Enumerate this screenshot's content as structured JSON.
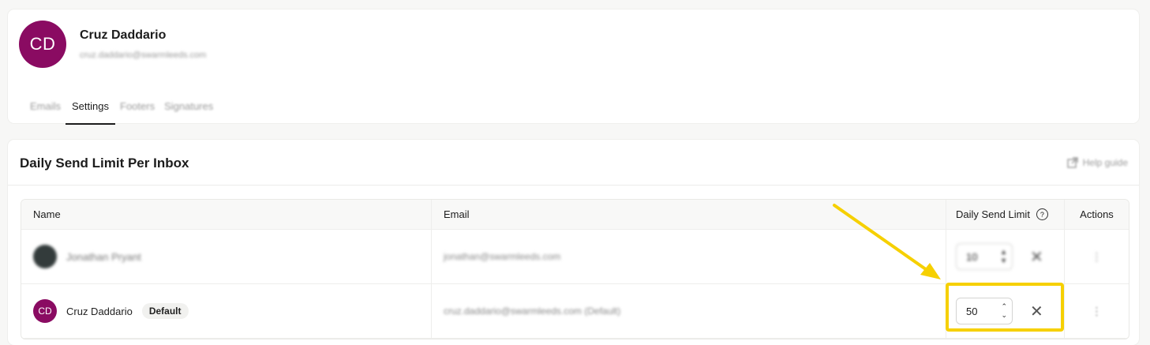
{
  "profile": {
    "initials": "CD",
    "name": "Cruz Daddario",
    "email": "cruz.daddario@swarmleeds.com",
    "avatar_color": "#8a0b62"
  },
  "tabs": [
    {
      "label": "Emails",
      "active": false
    },
    {
      "label": "Settings",
      "active": true
    },
    {
      "label": "Footers",
      "active": false
    },
    {
      "label": "Signatures",
      "active": false
    }
  ],
  "section": {
    "title": "Daily Send Limit Per Inbox",
    "help_label": "Help guide"
  },
  "table": {
    "headers": {
      "name": "Name",
      "email": "Email",
      "limit": "Daily Send Limit",
      "actions": "Actions"
    },
    "rows": [
      {
        "initials": "",
        "name": "Jonathan Pryant",
        "badge": "",
        "email": "jonathan@swarmleeds.com",
        "limit": "10",
        "actions_icon": "dots-vertical-icon"
      },
      {
        "initials": "CD",
        "name": "Cruz Daddario",
        "badge": "Default",
        "email": "cruz.daddario@swarmleeds.com (Default)",
        "limit": "50",
        "actions_icon": "dots-vertical-icon"
      }
    ]
  },
  "colors": {
    "accent_avatar": "#8a0b62",
    "highlight": "#f6d000"
  }
}
